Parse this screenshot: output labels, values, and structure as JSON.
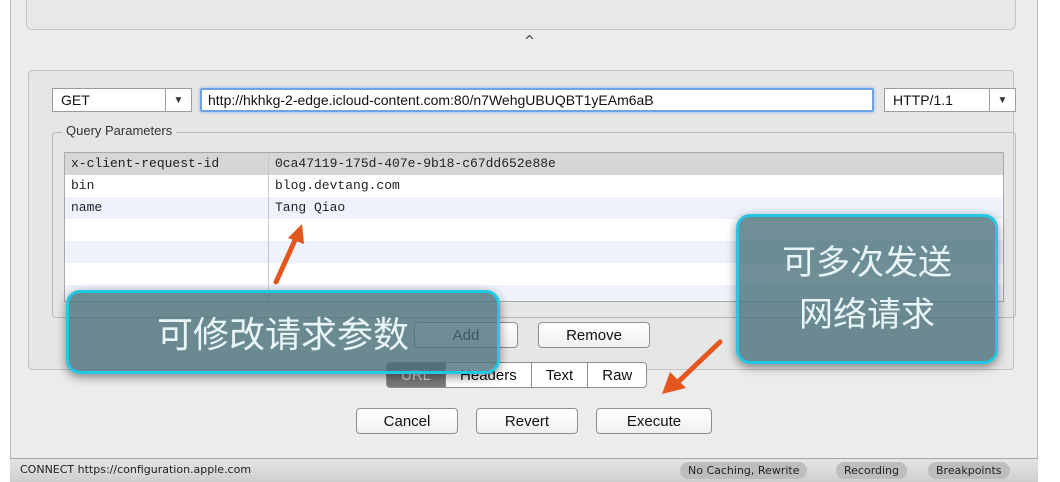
{
  "request": {
    "method": "GET",
    "url": "http://hkhkg-2-edge.icloud-content.com:80/n7WehgUBUQBT1yEAm6aB",
    "protocol": "HTTP/1.1"
  },
  "splitter_glyph": "^",
  "query_parameters": {
    "title": "Query Parameters",
    "rows": [
      {
        "name": "x-client-request-id",
        "value": "0ca47119-175d-407e-9b18-c67dd652e88e"
      },
      {
        "name": "bin",
        "value": "blog.devtang.com"
      },
      {
        "name": "name",
        "value": "Tang Qiao"
      },
      {
        "name": "",
        "value": ""
      },
      {
        "name": "",
        "value": ""
      },
      {
        "name": "",
        "value": ""
      },
      {
        "name": "",
        "value": ""
      }
    ]
  },
  "buttons": {
    "add": "Add",
    "remove": "Remove",
    "cancel": "Cancel",
    "revert": "Revert",
    "execute": "Execute"
  },
  "view_tabs": [
    {
      "label": "URL",
      "active": true
    },
    {
      "label": "Headers",
      "active": false
    },
    {
      "label": "Text",
      "active": false
    },
    {
      "label": "Raw",
      "active": false
    }
  ],
  "status_bar": {
    "connect_text": "CONNECT https://configuration.apple.com",
    "pills": [
      "No Caching, Rewrite",
      "Recording",
      "Breakpoints"
    ]
  },
  "annotations": {
    "modify_params": "可修改请求参数",
    "resend_line1": "可多次发送",
    "resend_line2": "网络请求"
  },
  "colors": {
    "callout_border": "#22c7e3",
    "arrow": "#e4561e",
    "url_focus": "#6fa3e8"
  }
}
